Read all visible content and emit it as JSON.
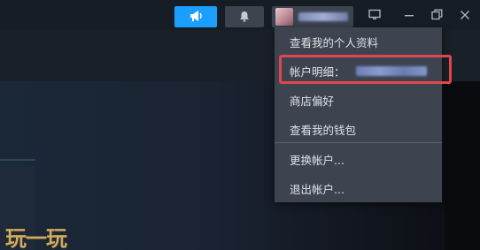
{
  "titlebar": {
    "announce_icon": "megaphone-icon",
    "notification_icon": "bell-icon",
    "account": {
      "avatar_icon": "avatar",
      "name_blurred": "••••••"
    },
    "window_controls": {
      "big_picture_icon": "monitor-icon",
      "minimize_icon": "minimize-icon",
      "restore_icon": "restore-icon",
      "close_icon": "close-icon"
    },
    "accent_color": "#1a9fff"
  },
  "account_menu": {
    "items": [
      {
        "label": "查看我的个人资料"
      },
      {
        "label": "帐户明细：",
        "detail_blurred": "••••••••"
      },
      {
        "label": "商店偏好"
      },
      {
        "label": "查看我的钱包"
      },
      {
        "label": "更换帐户..."
      },
      {
        "label": "退出帐户..."
      }
    ],
    "highlight_color": "#e0474c"
  },
  "watermark": {
    "text": "玩一玩"
  }
}
